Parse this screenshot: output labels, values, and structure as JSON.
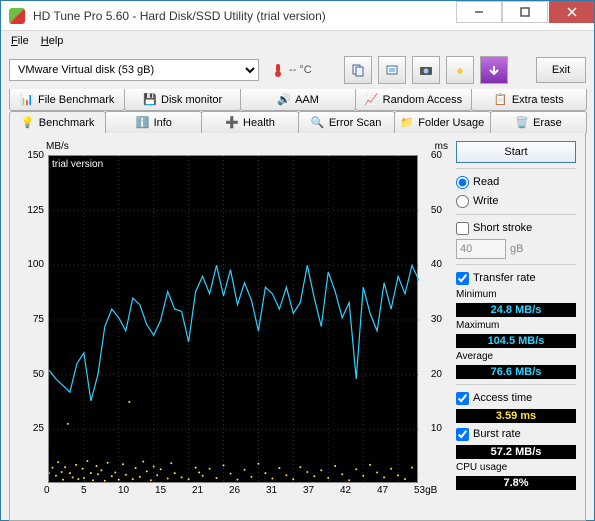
{
  "window": {
    "title": "HD Tune Pro 5.60 - Hard Disk/SSD Utility (trial version)"
  },
  "menu": {
    "file": "File",
    "help": "Help"
  },
  "toolbar": {
    "drive": "VMware  Virtual disk (53 gB)",
    "temp": "-- °C",
    "exit": "Exit"
  },
  "tabs_top": [
    {
      "label": "File Benchmark"
    },
    {
      "label": "Disk monitor"
    },
    {
      "label": "AAM"
    },
    {
      "label": "Random Access"
    },
    {
      "label": "Extra tests"
    }
  ],
  "tabs_bottom": [
    {
      "label": "Benchmark"
    },
    {
      "label": "Info"
    },
    {
      "label": "Health"
    },
    {
      "label": "Error Scan"
    },
    {
      "label": "Folder Usage"
    },
    {
      "label": "Erase"
    }
  ],
  "side": {
    "start": "Start",
    "read": "Read",
    "write": "Write",
    "short_stroke": "Short stroke",
    "short_stroke_val": "40",
    "gb": "gB",
    "transfer_rate": "Transfer rate",
    "min_label": "Minimum",
    "min": "24.8 MB/s",
    "max_label": "Maximum",
    "max": "104.5 MB/s",
    "avg_label": "Average",
    "avg": "76.6 MB/s",
    "access_label": "Access time",
    "access": "3.59 ms",
    "burst_label": "Burst rate",
    "burst": "57.2 MB/s",
    "cpu_label": "CPU usage",
    "cpu": "7.8%"
  },
  "chart_axes": {
    "y_left_label": "MB/s",
    "y_right_label": "ms",
    "y_left_ticks": [
      "150",
      "125",
      "100",
      "75",
      "50",
      "25"
    ],
    "y_right_ticks": [
      "60",
      "50",
      "40",
      "30",
      "20",
      "10"
    ],
    "x_ticks": [
      "0",
      "5",
      "10",
      "15",
      "21",
      "26",
      "31",
      "37",
      "42",
      "47",
      "53gB"
    ],
    "watermark": "trial version"
  },
  "chart_data": {
    "type": "line",
    "title": "",
    "xlabel": "gB",
    "ylabel_left": "MB/s",
    "ylabel_right": "ms",
    "xlim": [
      0,
      53
    ],
    "ylim_left": [
      0,
      150
    ],
    "ylim_right": [
      0,
      60
    ],
    "series": [
      {
        "name": "Transfer rate (MB/s)",
        "axis": "left",
        "color": "#2dd3ff",
        "x": [
          0,
          1,
          2,
          3,
          4,
          5,
          6,
          7,
          8,
          9,
          10,
          11,
          12,
          13,
          14,
          15,
          16,
          17,
          18,
          19,
          20,
          21,
          22,
          23,
          24,
          25,
          26,
          27,
          28,
          29,
          30,
          31,
          32,
          33,
          34,
          35,
          36,
          37,
          38,
          39,
          40,
          41,
          42,
          43,
          44,
          45,
          46,
          47,
          48,
          49,
          50,
          51,
          52,
          53
        ],
        "values": [
          52,
          48,
          45,
          42,
          55,
          60,
          38,
          50,
          72,
          80,
          76,
          70,
          85,
          82,
          73,
          68,
          75,
          88,
          80,
          79,
          65,
          88,
          95,
          87,
          100,
          86,
          98,
          82,
          92,
          84,
          70,
          90,
          87,
          80,
          90,
          78,
          83,
          100,
          85,
          72,
          97,
          88,
          76,
          83,
          48,
          90,
          78,
          70,
          92,
          80,
          95,
          87,
          100,
          93
        ]
      },
      {
        "name": "Access time (ms)",
        "axis": "right",
        "color": "#ffe13b",
        "style": "scatter",
        "x": [
          0,
          0.5,
          1,
          1.3,
          1.8,
          2,
          2.3,
          2.7,
          3,
          3.4,
          3.9,
          4.2,
          4.8,
          5,
          5.5,
          6,
          6.3,
          6.8,
          7,
          7.5,
          8,
          8.4,
          9,
          9.5,
          10,
          10.6,
          11,
          11.5,
          12,
          12.4,
          13,
          13.5,
          14,
          14.6,
          15,
          15.5,
          16,
          17,
          17.5,
          18,
          19,
          20,
          21,
          21.5,
          22,
          23,
          24,
          25,
          26,
          27,
          28,
          29,
          30,
          31,
          32,
          33,
          34,
          35,
          36,
          37,
          38,
          39,
          40,
          41,
          42,
          43,
          44,
          45,
          46,
          47,
          48,
          49,
          50,
          51,
          52,
          53
        ],
        "values": [
          2,
          3,
          1.5,
          4,
          2.2,
          0.8,
          3.1,
          11,
          2,
          1.2,
          3.5,
          0.9,
          2.8,
          1.1,
          4.2,
          2,
          0.7,
          3.3,
          1.8,
          2.5,
          0.6,
          3.9,
          1.4,
          2.1,
          0.8,
          3.6,
          1.7,
          15,
          0.9,
          2.9,
          1.3,
          4.1,
          2.3,
          0.7,
          3.2,
          1.6,
          2.7,
          1,
          3.8,
          2,
          1.2,
          0.9,
          3,
          2.1,
          1.5,
          2.8,
          1.1,
          3.4,
          1.9,
          0.8,
          2.6,
          1.3,
          3.7,
          2,
          1,
          2.9,
          1.6,
          0.9,
          3.1,
          2.2,
          1.4,
          2.5,
          1.1,
          3.3,
          1.8,
          0.7,
          2.7,
          1.5,
          3.5,
          2.1,
          1.2,
          2.8,
          1.6,
          0.9,
          3,
          2
        ]
      }
    ]
  }
}
